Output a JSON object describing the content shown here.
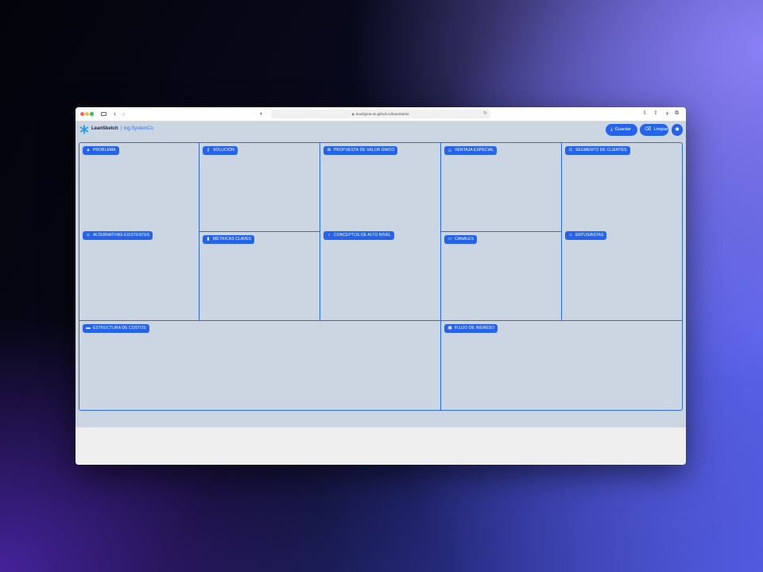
{
  "browser": {
    "url": "leanfigma-se.github.io/leanStarter",
    "icons": [
      "sidebar-icon",
      "back-icon",
      "forward-icon",
      "shield-icon",
      "lock-icon",
      "reload-icon",
      "download-icon",
      "share-icon",
      "add-tab-icon",
      "tabs-icon"
    ]
  },
  "app": {
    "brand_name": "LeanSketch",
    "brand_separator": "|",
    "project_name": "ing.SystemCo",
    "save_label": "Guardar",
    "clear_label": "Limpiar",
    "accent_color": "#2563eb"
  },
  "canvas": {
    "blocks": [
      {
        "id": "problem",
        "label": "PROBLEMA",
        "icon": "lock-icon"
      },
      {
        "id": "alternatives",
        "label": "ALTERNATIVAS EXISTENTES",
        "icon": "people-icon"
      },
      {
        "id": "solution",
        "label": "SOLUCION",
        "icon": "key-icon"
      },
      {
        "id": "metrics",
        "label": "MÉTRICAS CLAVES",
        "icon": "bar-chart-icon"
      },
      {
        "id": "value",
        "label": "PROPUESTA DE VALOR ÚNICO",
        "icon": "gift-icon"
      },
      {
        "id": "concepts",
        "label": "CONCEPTOS DE ALTO NIVEL",
        "icon": "bulb-icon"
      },
      {
        "id": "advantage",
        "label": "VENTAJA ESPECIAL",
        "icon": "flask-icon"
      },
      {
        "id": "channels",
        "label": "CANALES",
        "icon": "truck-icon"
      },
      {
        "id": "segments",
        "label": "SEGMENTO DE CLIENTES",
        "icon": "users-icon"
      },
      {
        "id": "early",
        "label": "ENTUSIASTAS",
        "icon": "star-person-icon"
      },
      {
        "id": "costs",
        "label": "ESTRUCTURA DE COSTOS",
        "icon": "tag-icon"
      },
      {
        "id": "revenue",
        "label": "FLUJO DE INGRESO",
        "icon": "money-icon"
      }
    ]
  }
}
